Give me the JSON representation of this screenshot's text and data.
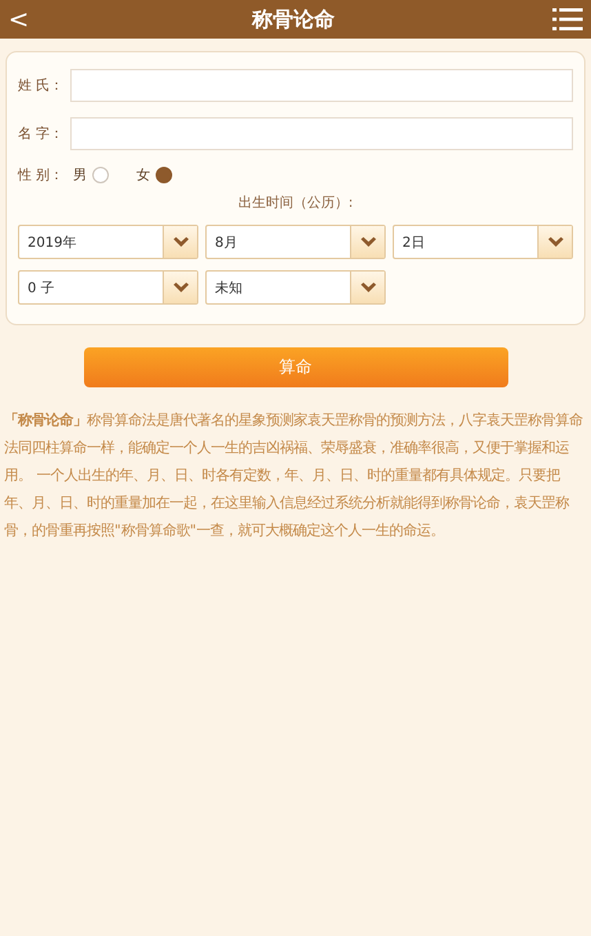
{
  "header": {
    "back": "<",
    "title": "称骨论命"
  },
  "form": {
    "surname_label": "姓 氏：",
    "name_label": "名 字：",
    "gender_label": "性 别：",
    "genders": [
      {
        "label": "男",
        "selected": false
      },
      {
        "label": "女",
        "selected": true
      }
    ],
    "birth_label": "出生时间（公历）:",
    "selects": [
      {
        "value": "2019年"
      },
      {
        "value": "8月"
      },
      {
        "value": "2日"
      },
      {
        "value": "0 子"
      },
      {
        "value": "未知"
      }
    ]
  },
  "submit": "算命",
  "intro": "**「称骨论命」**称骨算命法是唐代著名的星象预测家袁天罡称骨的预测方法，八字袁天罡称骨算命法同四柱算命一样，能确定一个人一生的吉凶祸福、荣辱盛衰，准确率很高，又便于掌握和运用。 一个人出生的年、月、日、时各有定数，年、月、日、时的重量都有具体规定。只要把年、月、日、时的重量加在一起，在这里输入信息经过系统分析就能得到称骨论命，袁天罡称骨，的骨重再按照\"称骨算命歌\"一查，就可大概确定这个人一生的命运。"
}
